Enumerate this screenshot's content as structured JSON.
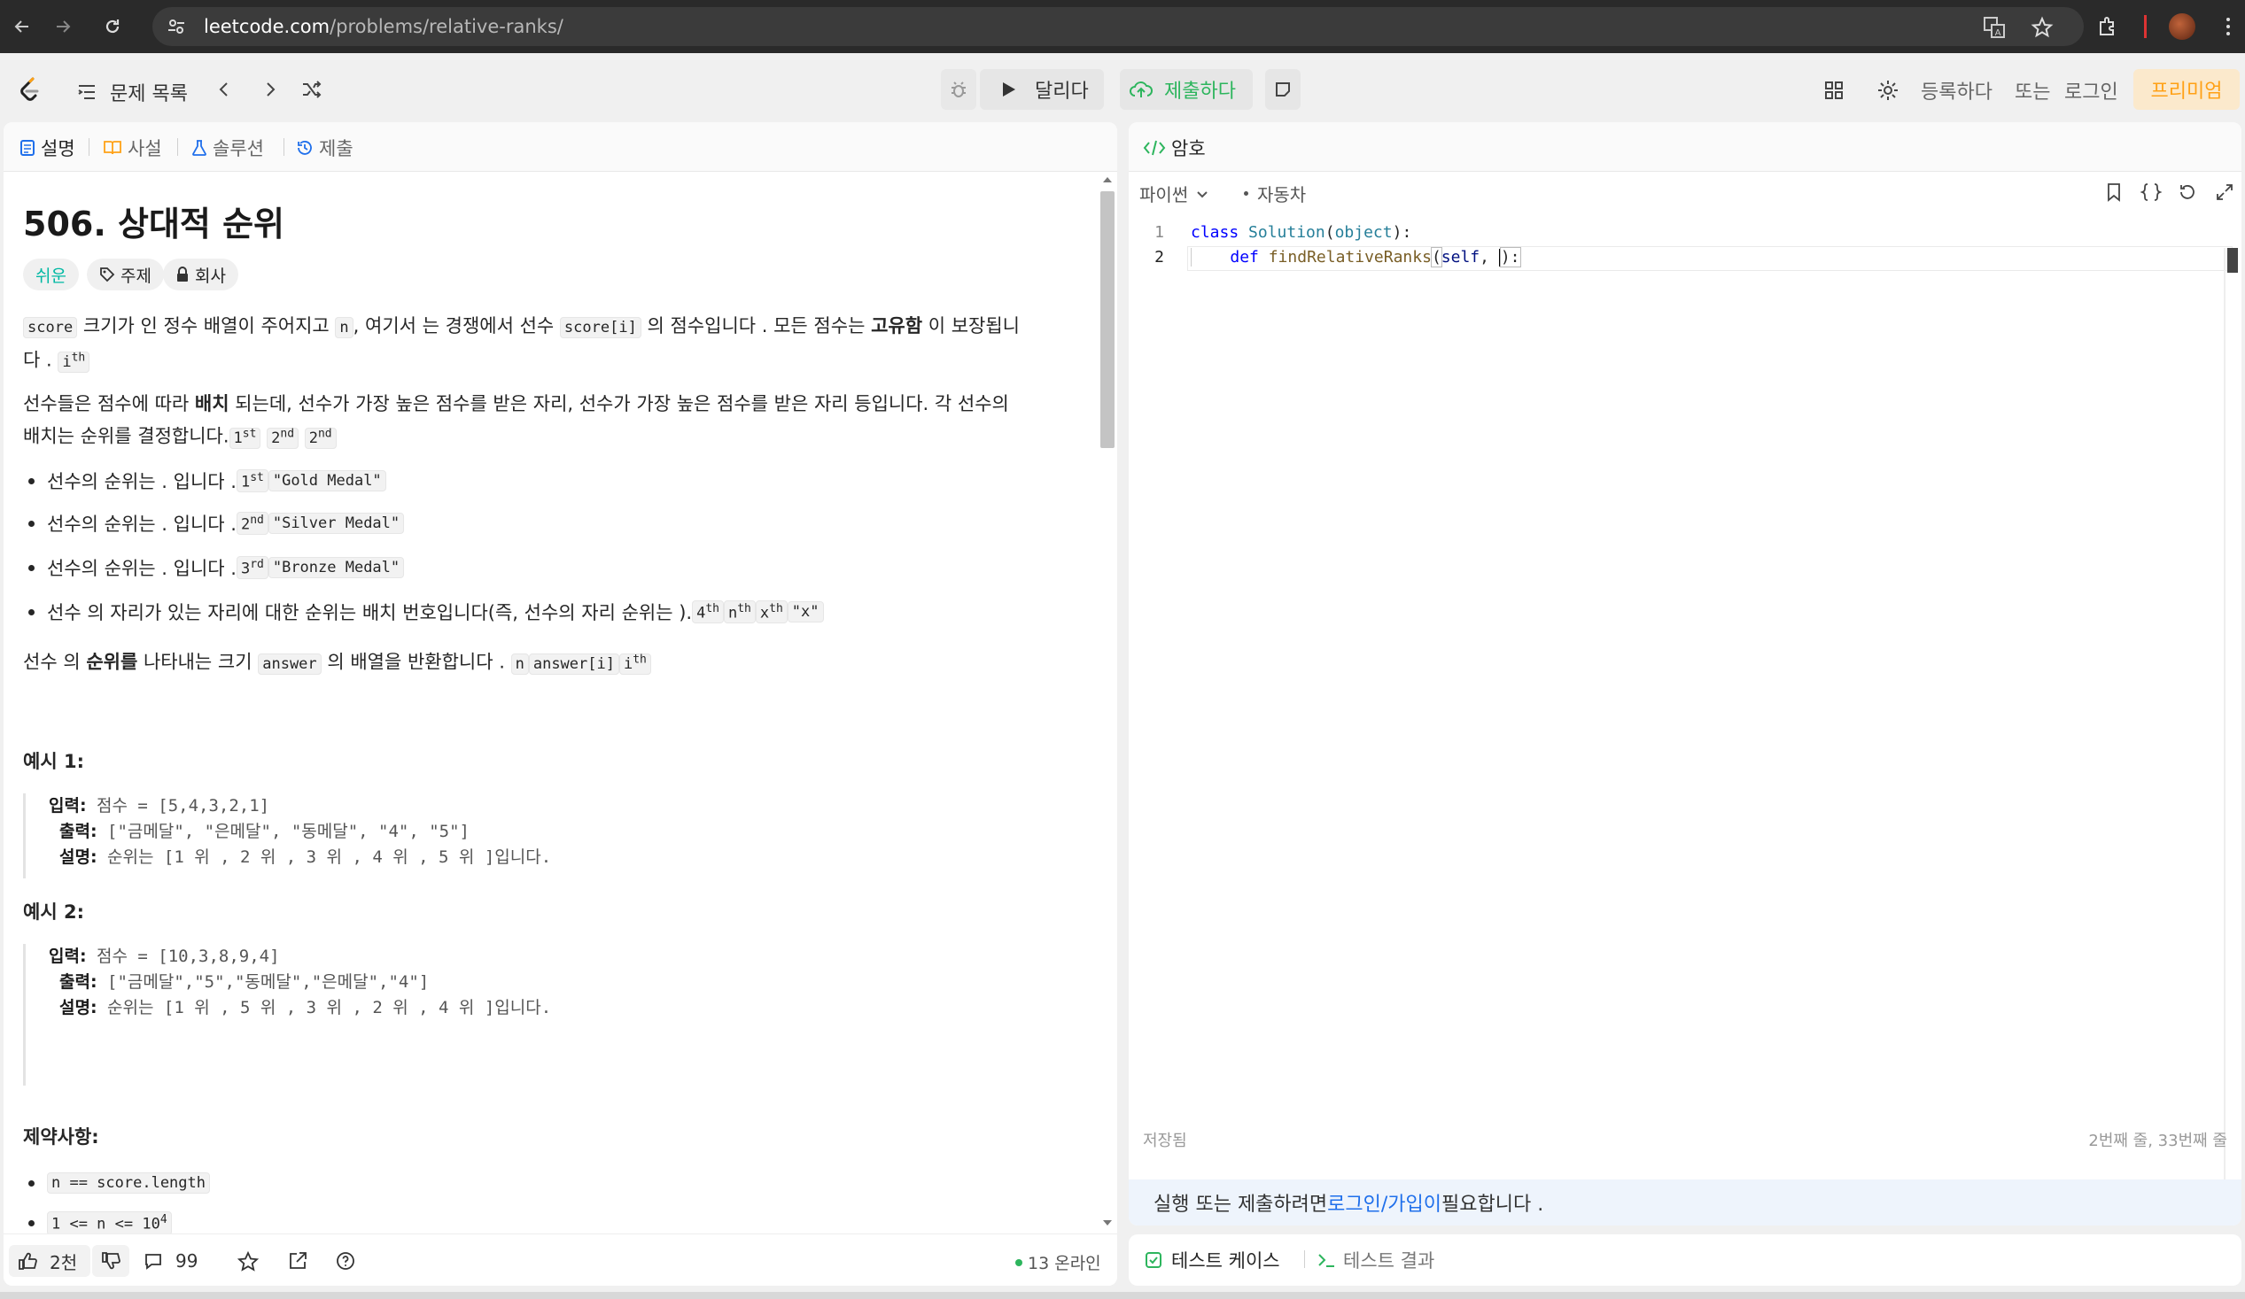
{
  "browser": {
    "url_host": "leetcode.com",
    "url_path": "/problems/relative-ranks/"
  },
  "nav": {
    "problem_list": "문제 목록",
    "run_label": "달리다",
    "submit_label": "제출하다",
    "register": "등록하다",
    "or": "또는",
    "login": "로그인",
    "premium": "프리미엄"
  },
  "left_tabs": [
    "설명",
    "사설",
    "솔루션",
    "제출"
  ],
  "problem": {
    "title": "506. 상대적 순위",
    "difficulty": "쉬운",
    "topics": "주제",
    "company": "회사",
    "p1_a": "score",
    "p1_b": " 크기가 인 정수 배열이 주어지고 ",
    "p1_c": "n",
    "p1_d": ", 여기서 는 경쟁에서 선수 ",
    "p1_e": "score[i]",
    "p1_f": " 의 점수입니다 . 모든 점수는 ",
    "p1_g": "고유함",
    "p1_h": " 이 보장됩니",
    "p1_i": "다 . ",
    "p1_j": "i",
    "p1_k": "th",
    "p2_a": "선수들은 점수에 따라 ",
    "p2_b": "배치",
    "p2_c": " 되는데, 선수가 가장 높은 점수를 받은 자리, 선수가 가장 높은 점수를 받은 자리 등입니다. 각 선수의",
    "p2_d": "배치는 순위를 결정합니다.",
    "p2_e": "1",
    "p2_f": "st",
    "p2_g": "2",
    "p2_h": "nd",
    "p2_i": "2",
    "p2_j": "nd",
    "bullets": [
      {
        "text": "선수의 순위는 . 입니다 . ",
        "n": "1",
        "sup": "st",
        "code": "\"Gold Medal\""
      },
      {
        "text": "선수의 순위는 . 입니다 . ",
        "n": "2",
        "sup": "nd",
        "code": "\"Silver Medal\""
      },
      {
        "text": "선수의 순위는 . 입니다 . ",
        "n": "3",
        "sup": "rd",
        "code": "\"Bronze Medal\""
      }
    ],
    "b4_text": "선수 의 자리가 있는 자리에 대한 순위는 배치 번호입니다(즉, 선수의 자리 순위는 ). ",
    "b4_n": "4",
    "b4_sup": "th",
    "b4_c1": "n",
    "b4_c1s": "th",
    "b4_c2": "x",
    "b4_c2s": "th",
    "b4_c3": "\"x\"",
    "ret_a": "선수 의 ",
    "ret_b": "순위를",
    "ret_c": " 나타내는 크기 ",
    "ret_d": "answer",
    "ret_e": " 의 배열을 반환합니다 . ",
    "ret_f": "n",
    "ret_g": "answer[i]",
    "ret_h": "i",
    "ret_i": "th",
    "ex1_title": "예시 1:",
    "ex1_in_label": "입력:",
    "ex1_in": " 점수 = [5,4,3,2,1]",
    "ex1_out_label": "출력:",
    "ex1_out": " [\"금메달\", \"은메달\", \"동메달\", \"4\", \"5\"]",
    "ex1_exp_label": "설명:",
    "ex1_exp": " 순위는 [1 위 , 2 위 , 3 위 , 4 위 , 5 위 ]입니다.",
    "ex2_title": "예시 2:",
    "ex2_in_label": "입력:",
    "ex2_in": " 점수 = [10,3,8,9,4]",
    "ex2_out_label": "출력:",
    "ex2_out": " [\"금메달\",\"5\",\"동메달\",\"은메달\",\"4\"]",
    "ex2_exp_label": "설명:",
    "ex2_exp": " 순위는 [1 위 , 5 위 , 3 위 , 2 위 , 4 위 ]입니다.",
    "constraints_title": "제약사항:",
    "c1": "n == score.length",
    "c2": "1 <= n <= 10",
    "c2_sup": "4"
  },
  "left_footer": {
    "likes": "2천",
    "comments": "99",
    "online": "13 온라인"
  },
  "editor": {
    "tab": "암호",
    "language": "파이썬",
    "auto": "자동차",
    "line_numbers": [
      "1",
      "2"
    ],
    "line1_kw": "class",
    "line1_cls": "Solution",
    "line1_open": "(",
    "line1_base": "object",
    "line1_close": "):",
    "line2_kw": "def",
    "line2_fn": "findRelativeRanks",
    "line2_open": "(",
    "line2_self": "self",
    "line2_rest": ", ",
    "line2_close": "):",
    "saved": "저장됨",
    "position": "2번째 줄, 33번째 줄",
    "login_prefix": "실행 또는 제출하려면 ",
    "login_link": "로그인/가입이",
    "login_suffix": " 필요합니다 ."
  },
  "bottom": {
    "testcase": "테스트 케이스",
    "result": "테스트 결과"
  },
  "colors": {
    "accent_green": "#2db55d",
    "premium_orange": "#ffa116",
    "easy_teal": "#00b8a3",
    "link_blue": "#1f6feb"
  }
}
